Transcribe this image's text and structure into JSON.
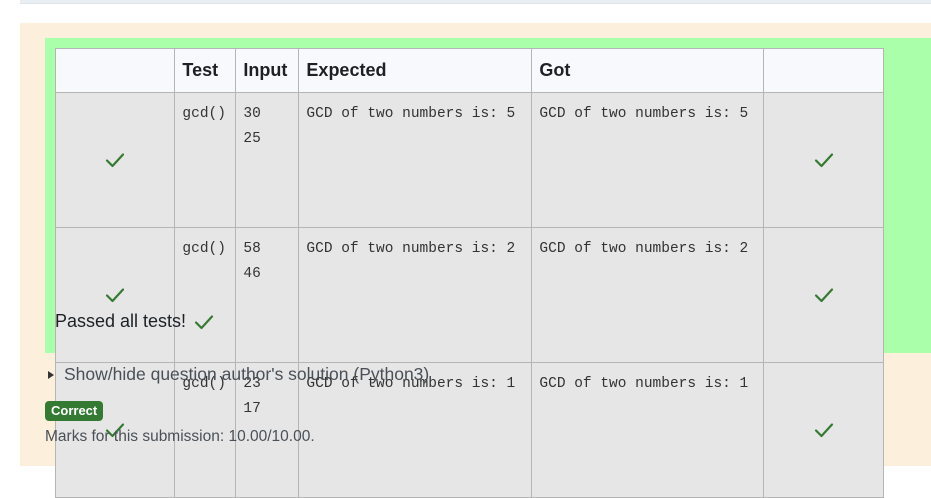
{
  "results_table": {
    "headers": [
      "",
      "Test",
      "Input",
      "Expected",
      "Got",
      ""
    ],
    "rows": [
      {
        "test": "gcd()",
        "input": "30\n25",
        "expected": "GCD of two numbers is: 5",
        "got": "GCD of two numbers is: 5"
      },
      {
        "test": "gcd()",
        "input": "58\n46",
        "expected": "GCD of two numbers is: 2",
        "got": "GCD of two numbers is: 2"
      },
      {
        "test": "gcd()",
        "input": "23\n17",
        "expected": "GCD of two numbers is: 1",
        "got": "GCD of two numbers is: 1"
      }
    ]
  },
  "summary": {
    "passed_text": "Passed all tests!"
  },
  "solution_toggle": {
    "label": "Show/hide question author's solution (Python3)"
  },
  "grade": {
    "badge": "Correct",
    "marks_text": "Marks for this submission: 10.00/10.00."
  },
  "icons": {
    "check": "check-icon",
    "toggle": "disclosure-triangle-icon"
  },
  "colors": {
    "pass_green": "#aaffaa",
    "check_green": "#357a32",
    "panel_bg": "#fcefdc"
  }
}
